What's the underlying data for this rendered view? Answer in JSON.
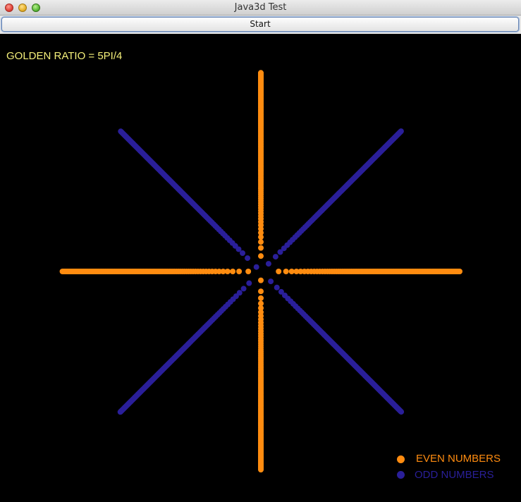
{
  "window": {
    "title": "Java3d Test"
  },
  "toolbar": {
    "start_label": "Start"
  },
  "canvas": {
    "ratio_label": "GOLDEN RATIO = 5PI/4",
    "divergence_angle_radians": 3.9269908,
    "point_count": 1000,
    "background_color": "#000000",
    "even_color": "#ff8c10",
    "odd_color": "#2a1f99",
    "label_color": "#f5f07a"
  },
  "legend": {
    "even_label": "EVEN NUMBERS",
    "odd_label": "ODD NUMBERS"
  }
}
